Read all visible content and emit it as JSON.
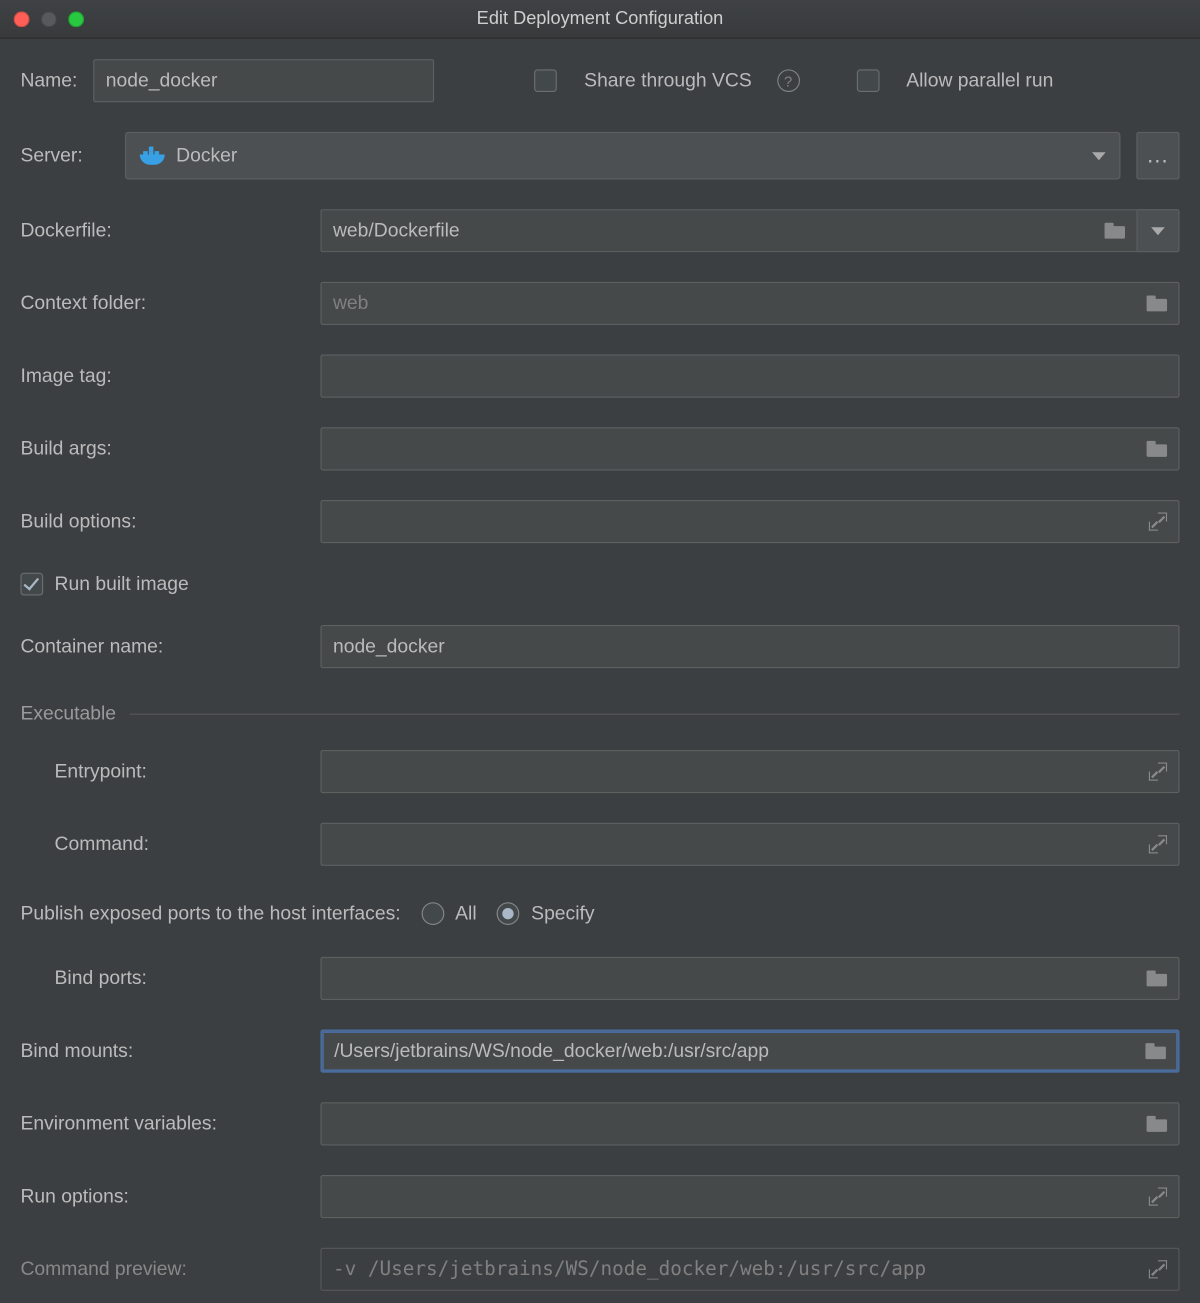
{
  "window": {
    "title": "Edit Deployment Configuration"
  },
  "topRow": {
    "nameLabel": "Name:",
    "nameValue": "node_docker",
    "shareVCSLabel": "Share through VCS",
    "shareVCSChecked": false,
    "allowParallelLabel": "Allow parallel run",
    "allowParallelChecked": false
  },
  "serverRow": {
    "label": "Server:",
    "value": "Docker",
    "moreLabel": "…"
  },
  "fields": {
    "dockerfile": {
      "label": "Dockerfile:",
      "value": "web/Dockerfile"
    },
    "contextFolder": {
      "label": "Context folder:",
      "placeholder": "web",
      "value": ""
    },
    "imageTag": {
      "label": "Image tag:",
      "value": ""
    },
    "buildArgs": {
      "label": "Build args:",
      "value": ""
    },
    "buildOptions": {
      "label": "Build options:",
      "value": ""
    },
    "runBuiltImage": {
      "label": "Run built image",
      "checked": true
    },
    "containerName": {
      "label": "Container name:",
      "value": "node_docker"
    }
  },
  "executable": {
    "sectionTitle": "Executable",
    "entrypoint": {
      "label": "Entrypoint:",
      "value": ""
    },
    "command": {
      "label": "Command:",
      "value": ""
    }
  },
  "publish": {
    "label": "Publish exposed ports to the host interfaces:",
    "options": {
      "all": "All",
      "specify": "Specify"
    },
    "selected": "specify"
  },
  "lower": {
    "bindPorts": {
      "label": "Bind ports:",
      "value": ""
    },
    "bindMounts": {
      "label": "Bind mounts:",
      "value": "/Users/jetbrains/WS/node_docker/web:/usr/src/app"
    },
    "envVars": {
      "label": "Environment variables:",
      "value": ""
    },
    "runOptions": {
      "label": "Run options:",
      "value": ""
    },
    "commandPreview": {
      "label": "Command preview:",
      "value": "-v /Users/jetbrains/WS/node_docker/web:/usr/src/app"
    }
  }
}
